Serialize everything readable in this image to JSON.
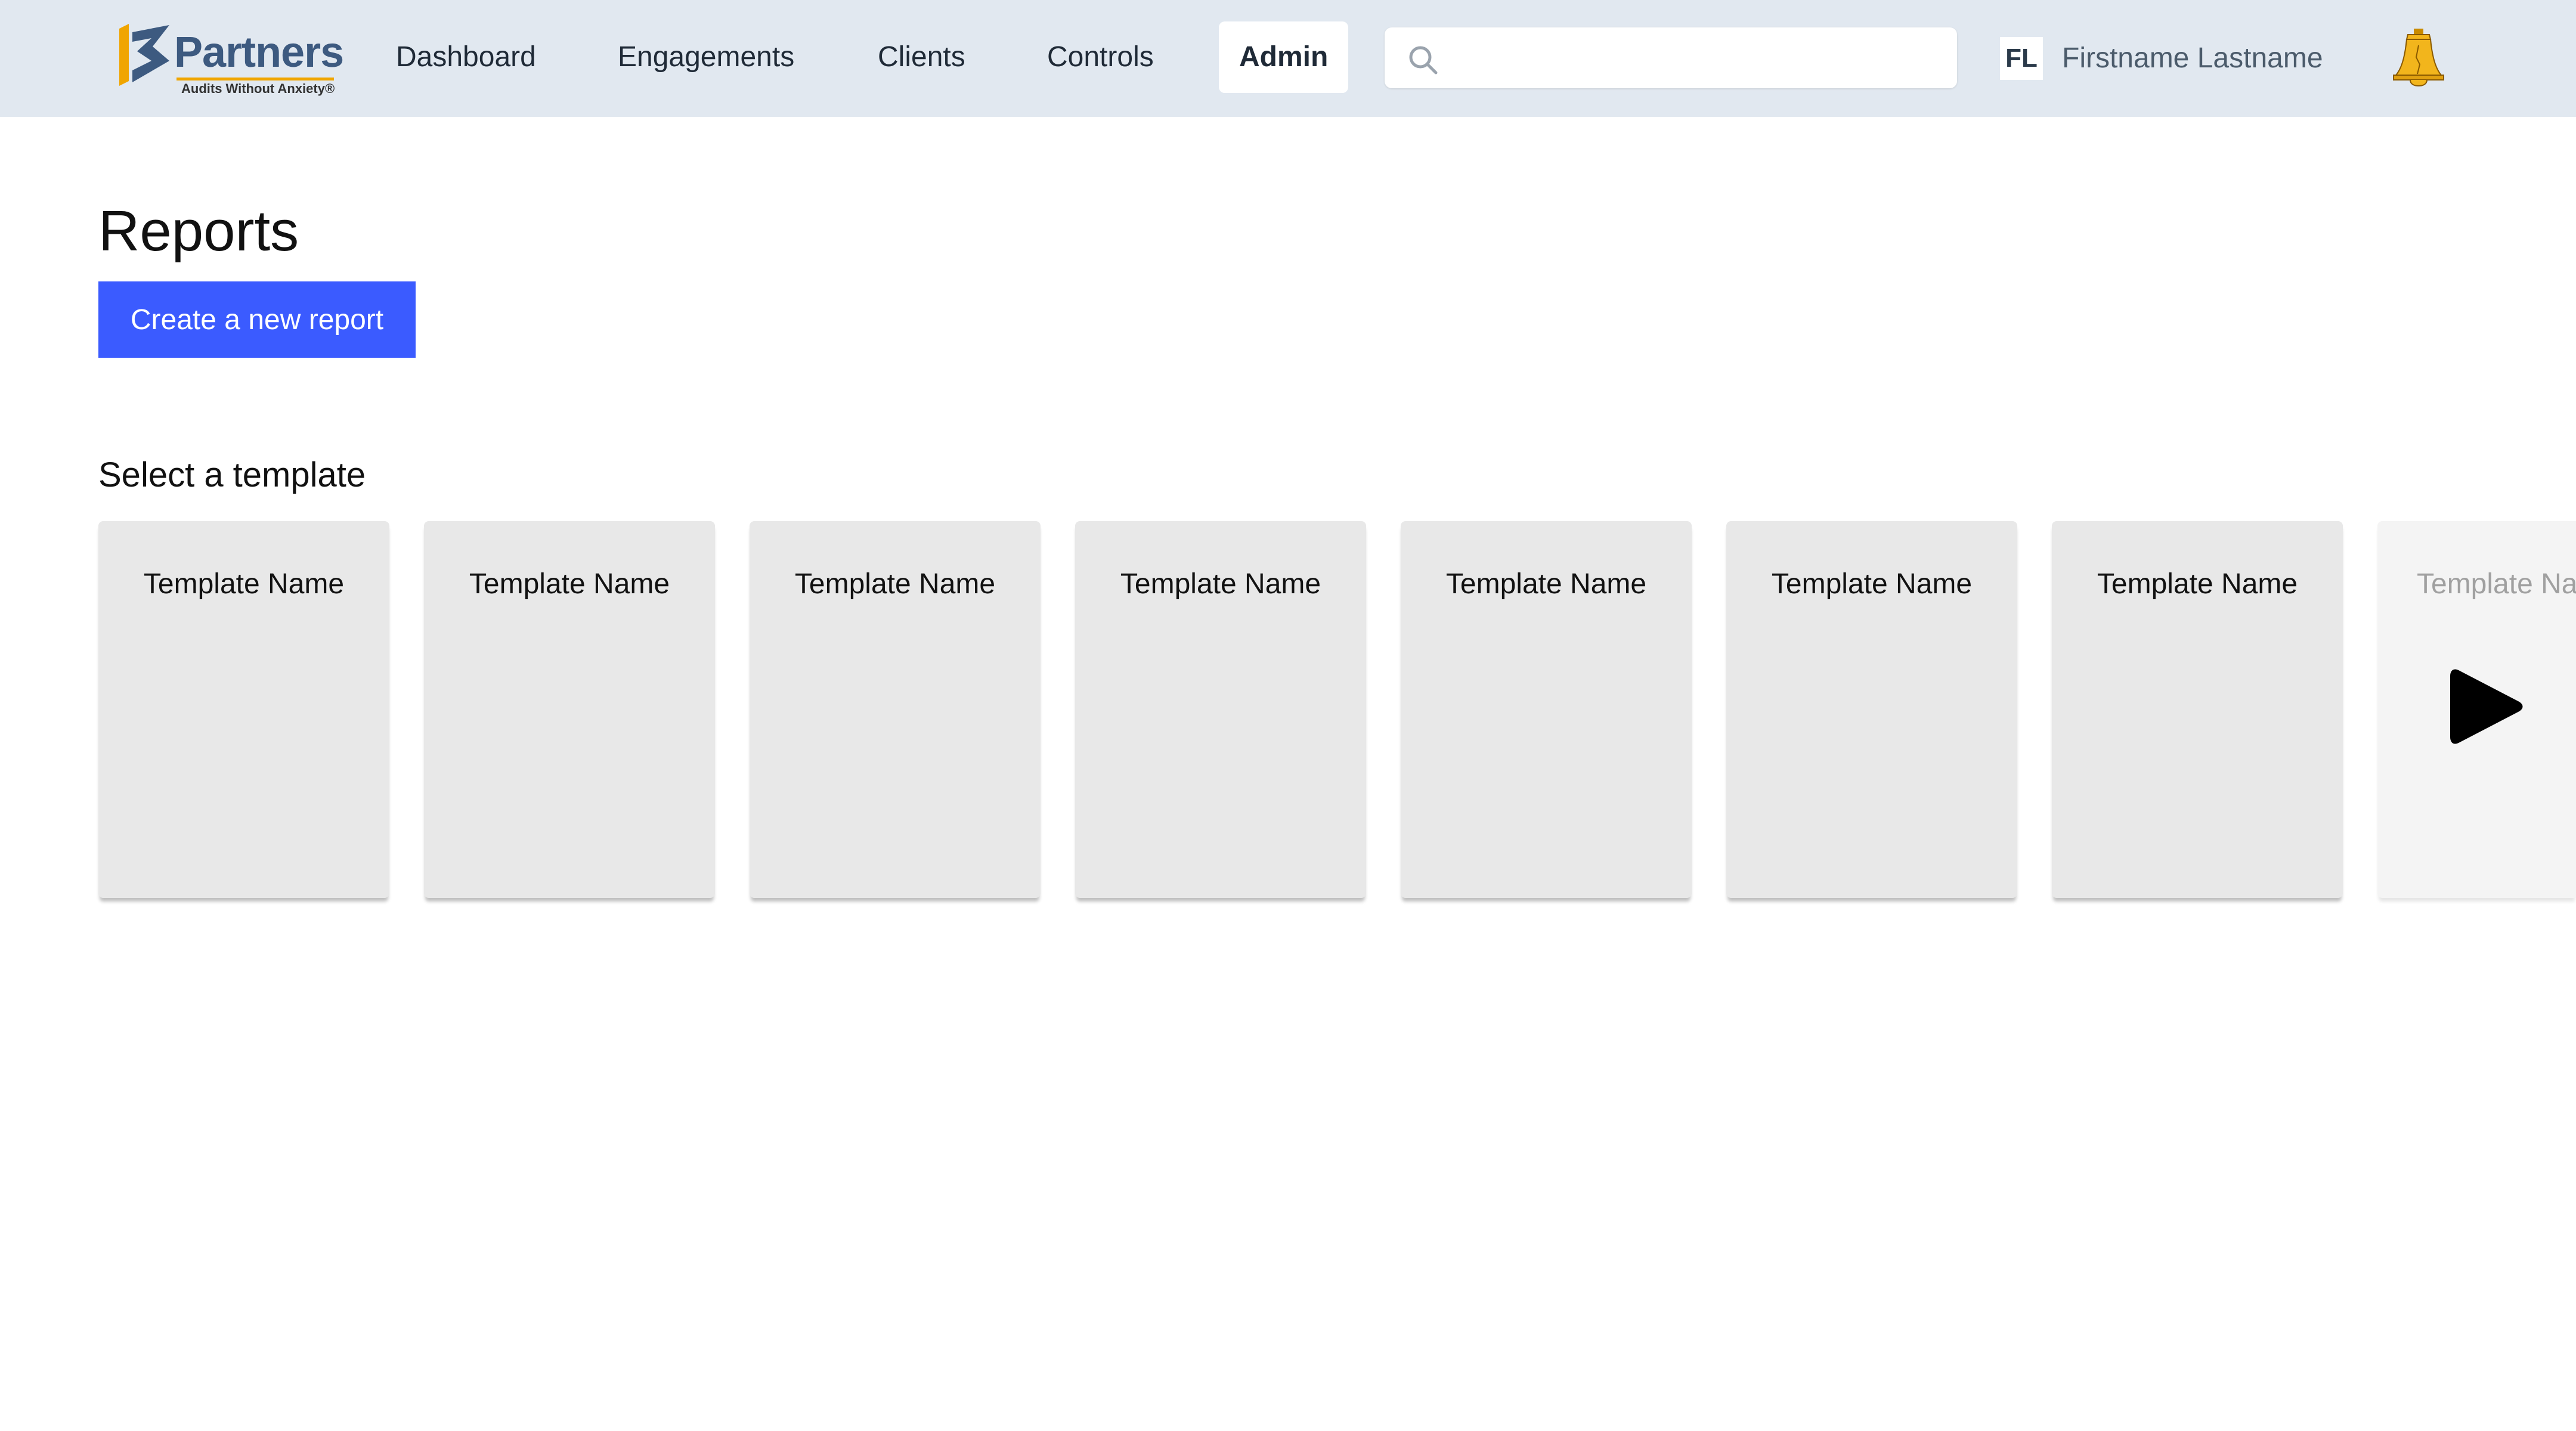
{
  "app": {
    "logo_text": "Partners",
    "logo_tagline": "Audits Without Anxiety®"
  },
  "nav": {
    "items": [
      {
        "label": "Dashboard"
      },
      {
        "label": "Engagements"
      },
      {
        "label": "Clients"
      },
      {
        "label": "Controls"
      },
      {
        "label": "Admin",
        "active": true
      }
    ]
  },
  "search": {
    "value": "",
    "placeholder": ""
  },
  "user": {
    "initials": "FL",
    "name": "Firstname Lastname"
  },
  "icons": {
    "search": "search-icon",
    "notifications": "liberty-bell-icon",
    "scroll_next": "play-icon"
  },
  "colors": {
    "topbar": "#e1e8f0",
    "primary_button": "#3b5bff",
    "card": "#e8e8e8",
    "bell": "#f2b51c"
  },
  "page": {
    "title": "Reports",
    "create_button": "Create a new report",
    "templates_heading": "Select a template"
  },
  "templates": [
    {
      "name": "Template Name"
    },
    {
      "name": "Template Name"
    },
    {
      "name": "Template Name"
    },
    {
      "name": "Template Name"
    },
    {
      "name": "Template Name"
    },
    {
      "name": "Template Name"
    },
    {
      "name": "Template Name"
    },
    {
      "name": "Template Na"
    }
  ]
}
